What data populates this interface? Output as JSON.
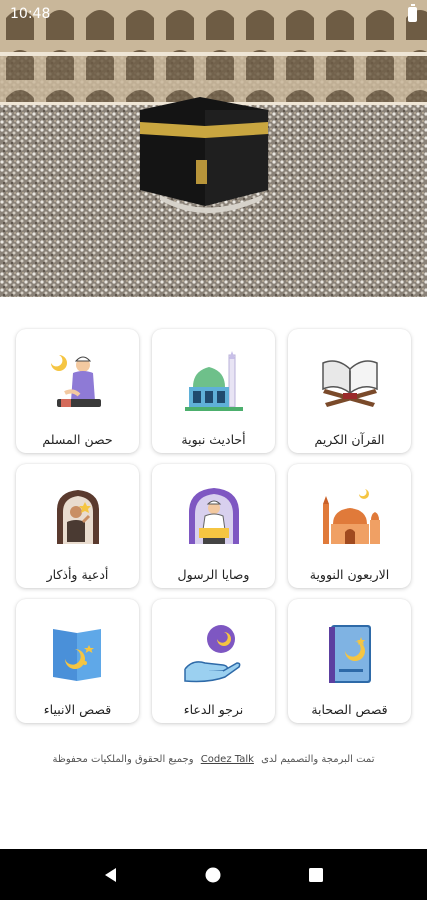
{
  "status_bar": {
    "time": "10:48"
  },
  "hero": {
    "image": "kaaba-photo"
  },
  "grid": {
    "items": [
      {
        "label": "القرآن الكريم",
        "icon": "quran-book-icon"
      },
      {
        "label": "أحاديث نبوية",
        "icon": "mosque-icon"
      },
      {
        "label": "حصن المسلم",
        "icon": "praying-man-icon"
      },
      {
        "label": "الاربعون النووية",
        "icon": "mosque-domes-icon"
      },
      {
        "label": "وصايا الرسول",
        "icon": "preacher-icon"
      },
      {
        "label": "أدعية وأذكار",
        "icon": "dua-man-icon"
      },
      {
        "label": "قصص الصحابة",
        "icon": "islamic-book-icon"
      },
      {
        "label": "نرجو الدعاء",
        "icon": "hand-moon-icon"
      },
      {
        "label": "قصص الانبياء",
        "icon": "moon-card-icon"
      }
    ]
  },
  "footer": {
    "text_before": "تمت البرمجة والتصميم لدى",
    "link": "Codez Talk",
    "text_after": "وجميع الحقوق والملكيات محفوظة"
  },
  "colors": {
    "accent_blue": "#4a90d9",
    "accent_purple": "#7e57c2",
    "accent_yellow": "#f5c542"
  }
}
